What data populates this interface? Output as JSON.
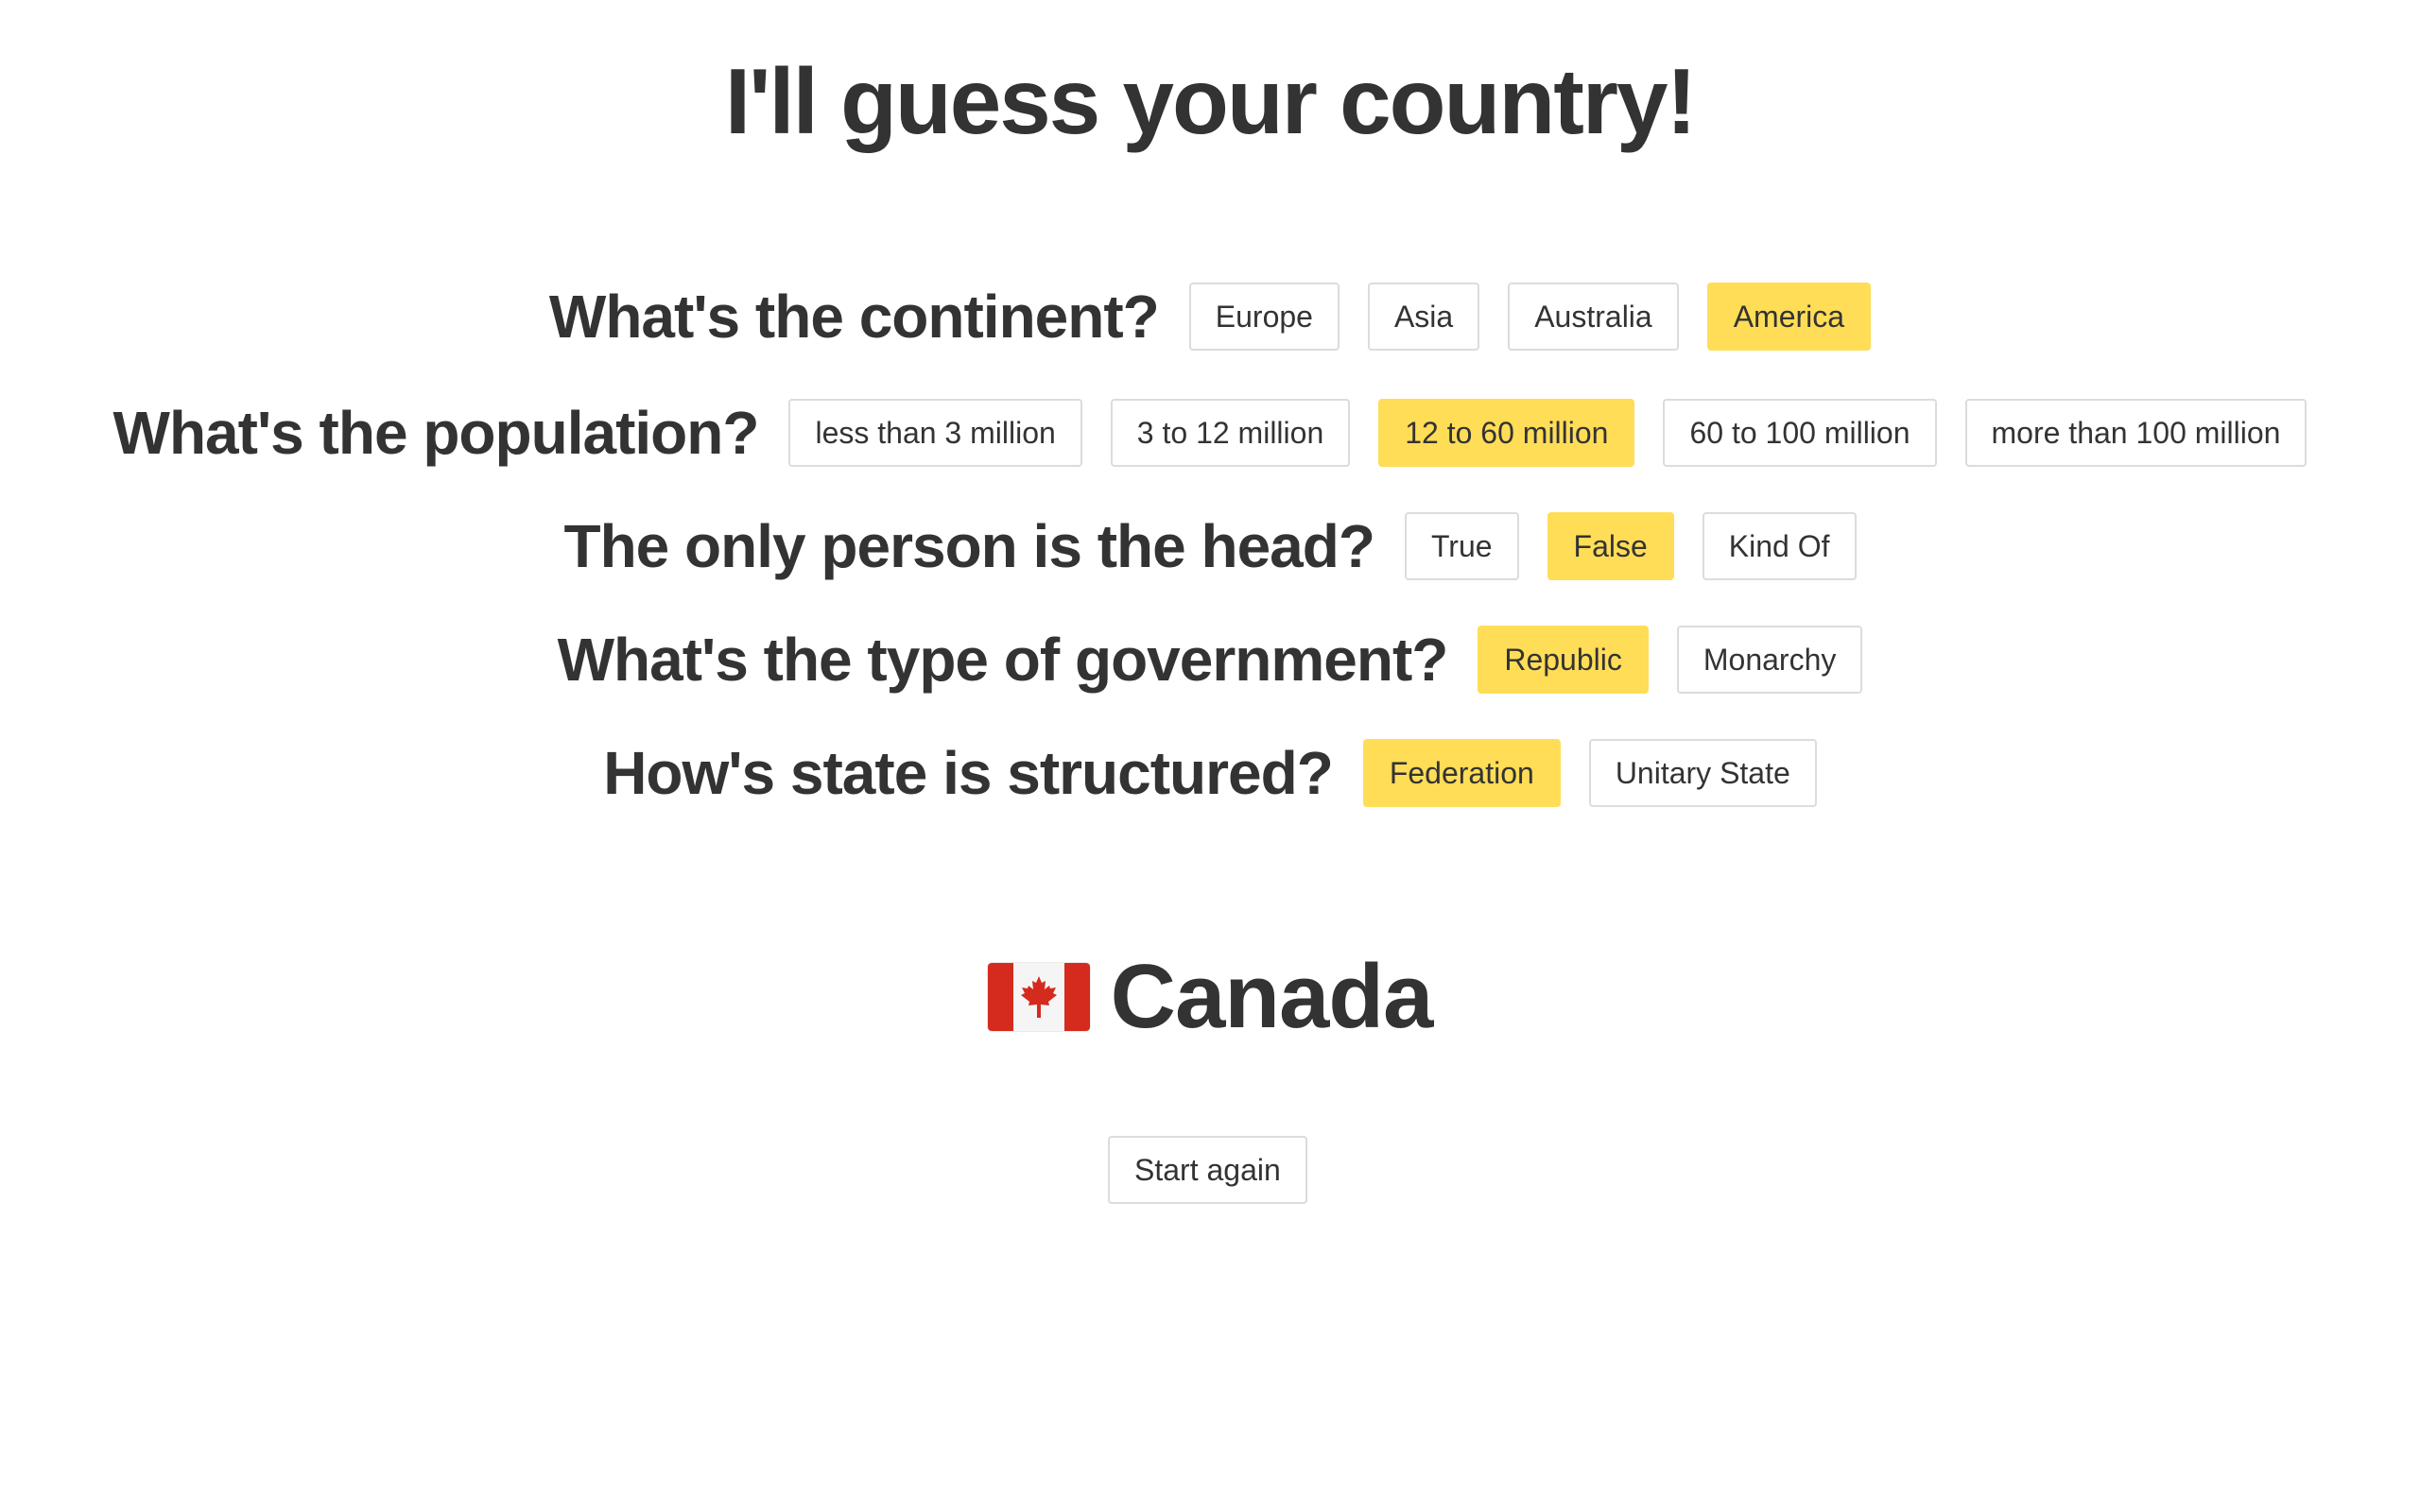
{
  "title": "I'll guess your country!",
  "questions": [
    {
      "label": "What's the continent?",
      "options": [
        "Europe",
        "Asia",
        "Australia",
        "America"
      ],
      "selected": "America"
    },
    {
      "label": "What's the population?",
      "options": [
        "less than 3 million",
        "3 to 12 million",
        "12 to 60 million",
        "60 to 100 million",
        "more than 100 million"
      ],
      "selected": "12 to 60 million"
    },
    {
      "label": "The only person is the head?",
      "options": [
        "True",
        "False",
        "Kind Of"
      ],
      "selected": "False"
    },
    {
      "label": "What's the type of government?",
      "options": [
        "Republic",
        "Monarchy"
      ],
      "selected": "Republic"
    },
    {
      "label": "How's state is structured?",
      "options": [
        "Federation",
        "Unitary State"
      ],
      "selected": "Federation"
    }
  ],
  "result": {
    "flag_icon": "canada-flag-icon",
    "country": "Canada"
  },
  "restart_label": "Start again",
  "colors": {
    "selected": "#ffdd57",
    "text": "#333333",
    "border": "#dcdcdc",
    "flag_red": "#d52b1e"
  }
}
